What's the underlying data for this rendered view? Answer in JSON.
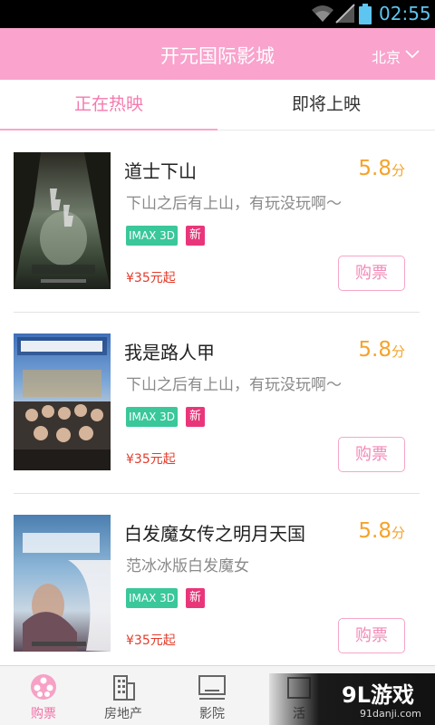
{
  "status_bar": {
    "time": "02:55",
    "icons": [
      "wifi-icon",
      "signal-icon",
      "battery-icon"
    ]
  },
  "header": {
    "title": "开元国际影城",
    "city": "北京"
  },
  "tabs": [
    {
      "label": "正在热映",
      "active": true
    },
    {
      "label": "即将上映",
      "active": false
    }
  ],
  "movies": [
    {
      "title": "道士下山",
      "score": "5.8",
      "score_unit": "分",
      "description": "下山之后有上山，有玩没玩啊～",
      "badge_format": "IMAX 3D",
      "badge_new": "新",
      "price": "¥35元起",
      "buy_label": "购票"
    },
    {
      "title": "我是路人甲",
      "score": "5.8",
      "score_unit": "分",
      "description": "下山之后有上山，有玩没玩啊～",
      "badge_format": "IMAX 3D",
      "badge_new": "新",
      "price": "¥35元起",
      "buy_label": "购票"
    },
    {
      "title": "白发魔女传之明月天国",
      "score": "5.8",
      "score_unit": "分",
      "description": "范冰冰版白发魔女",
      "badge_format": "IMAX 3D",
      "badge_new": "新",
      "price": "¥35元起",
      "buy_label": "购票"
    }
  ],
  "bottom_nav": [
    {
      "label": "购票",
      "icon": "film-reel-icon",
      "active": true
    },
    {
      "label": "房地产",
      "icon": "building-icon",
      "active": false
    },
    {
      "label": "影院",
      "icon": "screen-icon",
      "active": false
    },
    {
      "label": "活",
      "icon": "activity-icon",
      "active": false
    }
  ],
  "watermark": {
    "text": "9L游戏",
    "url_text": "91danji.com"
  },
  "colors": {
    "accent": "#f9a3cd",
    "score": "#f5a32a",
    "imax": "#3ac79a",
    "new": "#e9367a",
    "price": "#e33b2a"
  }
}
